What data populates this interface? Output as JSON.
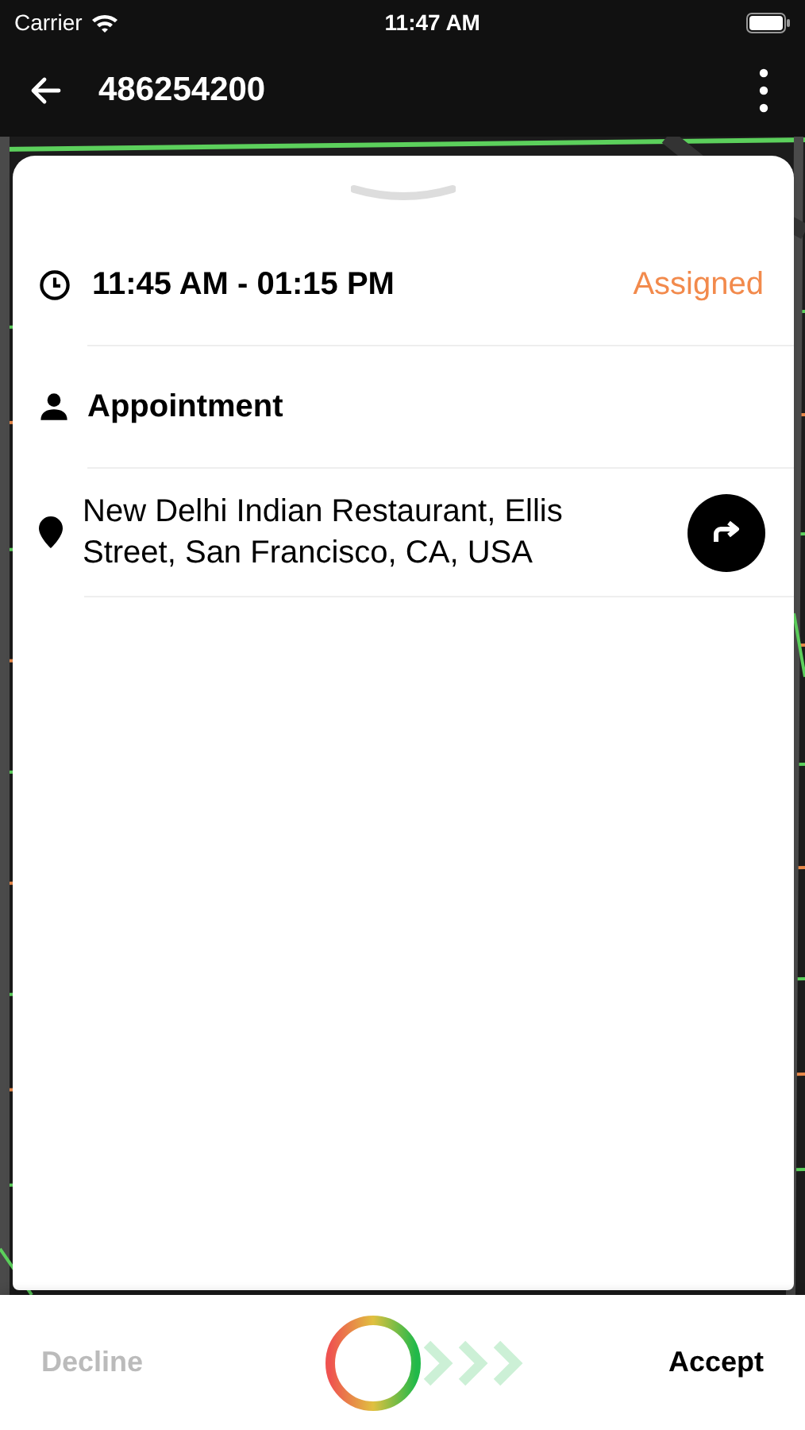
{
  "status_bar": {
    "carrier": "Carrier",
    "time": "11:47 AM"
  },
  "header": {
    "title": "486254200"
  },
  "details": {
    "time_range": "11:45 AM - 01:15 PM",
    "status": "Assigned",
    "type": "Appointment",
    "address": "New Delhi Indian Restaurant, Ellis Street, San Francisco, CA, USA"
  },
  "actions": [
    {
      "label": "Decline",
      "disabled": true
    },
    {
      "label": "Accept",
      "disabled": false
    }
  ]
}
